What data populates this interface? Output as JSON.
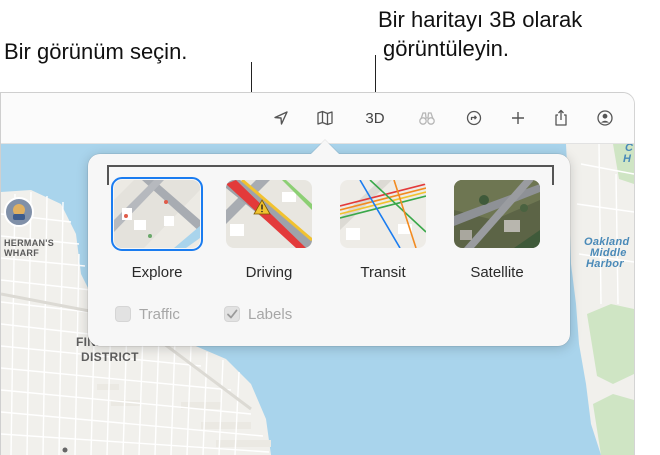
{
  "callouts": {
    "left": "Bir görünüm seçin.",
    "right_line1": "Bir haritayı 3B olarak",
    "right_line2": "görüntüleyin."
  },
  "toolbar": {
    "icons": [
      "location-arrow-icon",
      "map-icon",
      "3d-button",
      "binoculars-icon",
      "directions-icon",
      "plus-icon",
      "share-icon",
      "account-icon"
    ],
    "three_d_label": "3D"
  },
  "map": {
    "labels": {
      "fishermans_wharf_line1": "HERMAN'S",
      "fishermans_wharf_line2": "WHARF",
      "financial_line1": "FINANCIAL",
      "financial_line2": "DISTRICT",
      "oakland_line1": "Oakland",
      "oakland_line2": "Middle",
      "oakland_line3": "Harbor",
      "top_right_line1": "C",
      "top_right_line2": "H"
    },
    "colors": {
      "water": "#a9d4ec",
      "land": "#f1f0ec",
      "park": "#cfe5c4"
    }
  },
  "popover": {
    "views": [
      {
        "label": "Explore",
        "selected": true
      },
      {
        "label": "Driving",
        "selected": false
      },
      {
        "label": "Transit",
        "selected": false
      },
      {
        "label": "Satellite",
        "selected": false
      }
    ],
    "options": [
      {
        "label": "Traffic",
        "checked": false
      },
      {
        "label": "Labels",
        "checked": true
      }
    ]
  },
  "colors": {
    "accent": "#1a7cf0"
  }
}
